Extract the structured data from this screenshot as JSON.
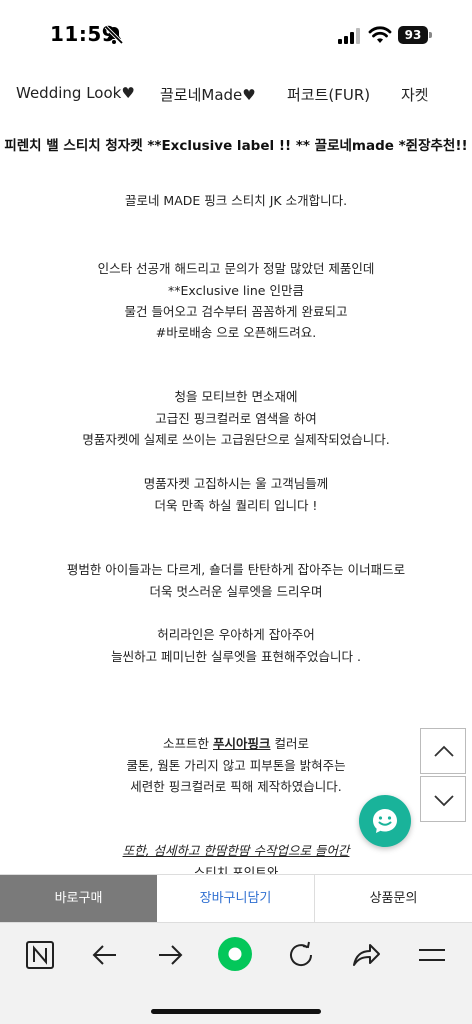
{
  "status_bar": {
    "time": "11:59",
    "battery": "93",
    "icons": [
      "bell-slash-icon",
      "signal-icon",
      "wifi-icon",
      "battery-icon"
    ]
  },
  "categories": [
    "Wedding Look♥",
    "끌로네Made♥",
    "퍼코트(FUR)",
    "자켓"
  ],
  "product_title": "피렌치 밸 스티치 청자켓 **Exclusive label !! ** 끌로네made *쥔장추천!!",
  "description": {
    "intro": "끌로네 MADE 핑크 스티치 JK 소개합니다.",
    "p1": [
      "인스타 선공개 해드리고 문의가 정말 많았던 제품인데",
      "**Exclusive line 인만큼",
      "물건 들어오고 검수부터 꼼꼼하게 완료되고",
      "#바로배송 으로 오픈해드려요."
    ],
    "p2": [
      "청을 모티브한 면소재에",
      "고급진 핑크컬러로 염색을 하여",
      "명품자켓에 실제로 쓰이는 고급원단으로 실제작되었습니다."
    ],
    "p3": [
      "명품자켓 고집하시는 울 고객님들께",
      "더욱 만족 하실 퀄리티 입니다 !"
    ],
    "p4": [
      "평범한 아이들과는 다르게, 숄더를 탄탄하게 잡아주는 이너패드로",
      "더욱 멋스러운 실루엣을 드리우며"
    ],
    "p5": [
      "허리라인은 우아하게 잡아주어",
      "늘씬하고 페미닌한 실루엣을 표현해주었습니다 ."
    ],
    "p6_line1_before": "소프트한 ",
    "p6_line1_highlight": "푸시아핑크",
    "p6_line1_after": " 컬러로",
    "p6_rest": [
      "쿨톤, 웜톤 가리지 않고 피부톤을 밝혀주는",
      "세련한 핑크컬러로 픽해 제작하였습니다."
    ],
    "p7": [
      "또한, 섬세하고 한땀한땀 수작업으로 들어간",
      "스티치 포인트와"
    ]
  },
  "action_bar": {
    "buy": "바로구매",
    "cart": "장바구니담기",
    "inquiry": "상품문의"
  },
  "colors": {
    "buy_bg": "#7a7a7a",
    "cart_text": "#2f6fd1",
    "chat_bg": "#19b39a",
    "naver_green": "#03c75a"
  },
  "browser_toolbar": {
    "icons": [
      "naver-n-icon",
      "back-arrow-icon",
      "forward-arrow-icon",
      "green-dot-icon",
      "reload-icon",
      "share-icon",
      "menu-icon"
    ],
    "n_label": "N"
  }
}
